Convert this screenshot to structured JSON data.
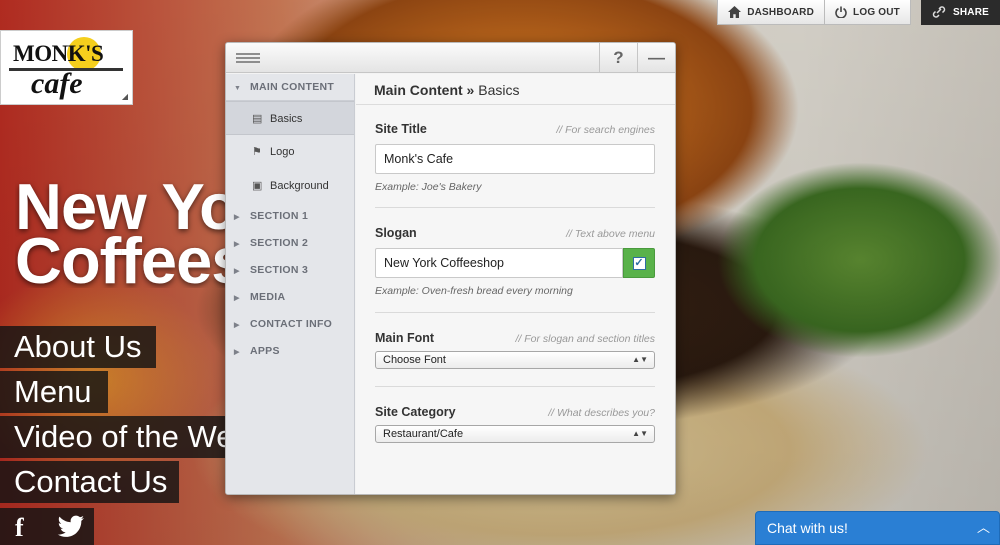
{
  "logo": {
    "top": "MONK'S",
    "bottom": "cafe"
  },
  "hero": {
    "line1": "New Yo",
    "line2": "Coffees"
  },
  "nav": [
    {
      "label": "About Us"
    },
    {
      "label": "Menu"
    },
    {
      "label": "Video of the We"
    },
    {
      "label": "Contact Us"
    }
  ],
  "social": {
    "facebook": "f"
  },
  "topbar": {
    "dashboard": "DASHBOARD",
    "logout": "LOG OUT",
    "share": "SHARE"
  },
  "panel": {
    "help_label": "?",
    "minimize_label": "—",
    "sidebar": {
      "open_section": "MAIN CONTENT",
      "sub_items": [
        {
          "label": "Basics",
          "icon": "list-icon"
        },
        {
          "label": "Logo",
          "icon": "flag-icon"
        },
        {
          "label": "Background",
          "icon": "image-icon"
        }
      ],
      "sections": [
        "SECTION 1",
        "SECTION 2",
        "SECTION 3",
        "MEDIA",
        "CONTACT INFO",
        "APPS"
      ]
    },
    "breadcrumb": {
      "parent": "Main Content",
      "sep": " » ",
      "current": "Basics"
    },
    "fields": {
      "site_title": {
        "label": "Site Title",
        "hint": "// For search engines",
        "value": "Monk's Cafe",
        "example": "Example: Joe's Bakery"
      },
      "slogan": {
        "label": "Slogan",
        "hint": "// Text above menu",
        "value": "New York Coffeeshop",
        "example": "Example: Oven-fresh bread every morning"
      },
      "main_font": {
        "label": "Main Font",
        "hint": "// For slogan and section titles",
        "selected": "Choose Font"
      },
      "site_category": {
        "label": "Site Category",
        "hint": "// What describes you?",
        "selected": "Restaurant/Cafe"
      }
    }
  },
  "chat": {
    "label": "Chat with us!"
  },
  "colors": {
    "accent_green": "#59b24a",
    "chat_blue": "#2a7fd4"
  }
}
